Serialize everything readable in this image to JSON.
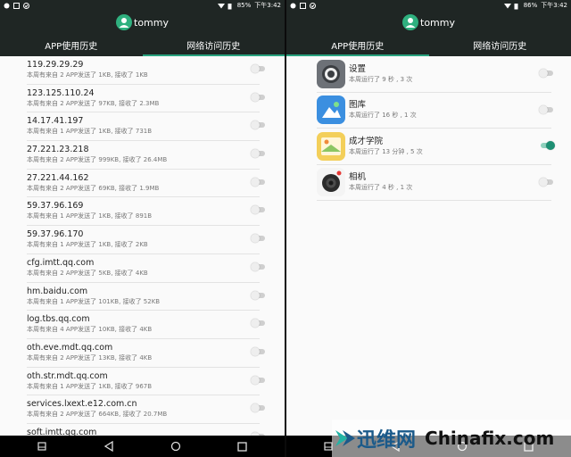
{
  "status_bar": {
    "left_battery": "85%",
    "left_time": "下午3:42",
    "right_battery": "86%",
    "right_time": "下午3:42"
  },
  "user": {
    "name": "tommy"
  },
  "tabs": {
    "app_history": "APP使用历史",
    "network_history": "网络访问历史"
  },
  "network_list": [
    {
      "host": "119.29.29.29",
      "detail": "本周有来自 2 APP发送了 1KB, 接收了 1KB"
    },
    {
      "host": "123.125.110.24",
      "detail": "本周有来自 2 APP发送了 97KB, 接收了 2.3MB"
    },
    {
      "host": "14.17.41.197",
      "detail": "本周有来自 1 APP发送了 1KB, 接收了 731B"
    },
    {
      "host": "27.221.23.218",
      "detail": "本周有来自 2 APP发送了 999KB, 接收了 26.4MB"
    },
    {
      "host": "27.221.44.162",
      "detail": "本周有来自 2 APP发送了 69KB, 接收了 1.9MB"
    },
    {
      "host": "59.37.96.169",
      "detail": "本周有来自 1 APP发送了 1KB, 接收了 891B"
    },
    {
      "host": "59.37.96.170",
      "detail": "本周有来自 1 APP发送了 1KB, 接收了 2KB"
    },
    {
      "host": "cfg.imtt.qq.com",
      "detail": "本周有来自 2 APP发送了 5KB, 接收了 4KB"
    },
    {
      "host": "hm.baidu.com",
      "detail": "本周有来自 1 APP发送了 101KB, 接收了 52KB"
    },
    {
      "host": "log.tbs.qq.com",
      "detail": "本周有来自 4 APP发送了 10KB, 接收了 4KB"
    },
    {
      "host": "oth.eve.mdt.qq.com",
      "detail": "本周有来自 2 APP发送了 13KB, 接收了 4KB"
    },
    {
      "host": "oth.str.mdt.qq.com",
      "detail": "本周有来自 1 APP发送了 1KB, 接收了 967B"
    },
    {
      "host": "services.lxext.e12.com.cn",
      "detail": "本周有来自 2 APP发送了 664KB, 接收了 20.7MB"
    },
    {
      "host": "soft.imtt.qq.com",
      "detail": ""
    }
  ],
  "app_list": [
    {
      "name": "设置",
      "detail": "本周运行了 9 秒 , 3 次",
      "icon": "settings-icon",
      "enabled": false
    },
    {
      "name": "图库",
      "detail": "本周运行了 16 秒 , 1 次",
      "icon": "gallery-icon",
      "enabled": false
    },
    {
      "name": "成才学院",
      "detail": "本周运行了 13 分钟 , 5 次",
      "icon": "academy-icon",
      "enabled": true
    },
    {
      "name": "相机",
      "detail": "本周运行了 4 秒 , 1 次",
      "icon": "camera-icon",
      "enabled": false
    }
  ],
  "watermark": {
    "brand": "迅维网",
    "site": "Chinafix.com"
  },
  "colors": {
    "header": "#1f2624",
    "accent": "#29a37f",
    "avatar": "#2fb07f"
  }
}
